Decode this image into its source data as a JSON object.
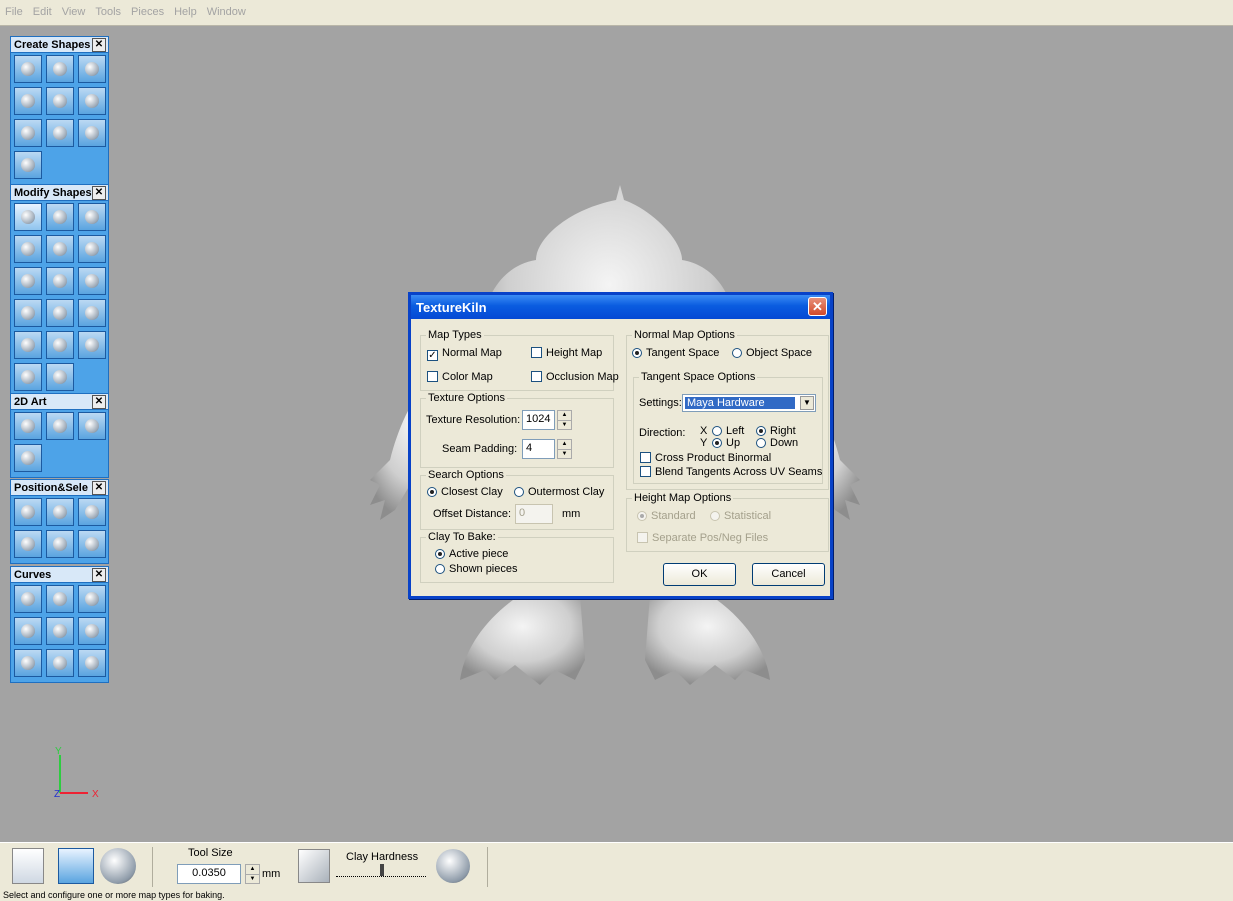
{
  "menubar": [
    "File",
    "Edit",
    "View",
    "Tools",
    "Pieces",
    "Help",
    "Window"
  ],
  "palettes": [
    {
      "title": "Create Shapes",
      "tools": 10
    },
    {
      "title": "Modify Shapes",
      "tools": 17
    },
    {
      "title": "2D Art",
      "tools": 4
    },
    {
      "title": "Position&Sele",
      "tools": 6
    },
    {
      "title": "Curves",
      "tools": 9
    }
  ],
  "dialog": {
    "title": "TextureKiln",
    "map_types": {
      "legend": "Map Types",
      "normal": "Normal Map",
      "normal_checked": true,
      "height": "Height Map",
      "height_checked": false,
      "color": "Color Map",
      "color_checked": false,
      "occlusion": "Occlusion Map",
      "occlusion_checked": false
    },
    "texture_options": {
      "legend": "Texture Options",
      "resolution_label": "Texture Resolution:",
      "resolution_value": "1024",
      "seam_label": "Seam Padding:",
      "seam_value": "4"
    },
    "search_options": {
      "legend": "Search Options",
      "closest": "Closest Clay",
      "outermost": "Outermost Clay",
      "selected": "closest",
      "offset_label": "Offset Distance:",
      "offset_value": "0",
      "offset_unit": "mm"
    },
    "clay_to_bake": {
      "legend": "Clay To Bake:",
      "active": "Active piece",
      "shown": "Shown pieces",
      "selected": "active"
    },
    "normal_map_options": {
      "legend": "Normal Map Options",
      "tangent": "Tangent Space",
      "object": "Object Space",
      "selected": "tangent"
    },
    "tangent_space_options": {
      "legend": "Tangent Space Options",
      "settings_label": "Settings:",
      "settings_value": "Maya Hardware",
      "direction_label": "Direction:",
      "x_axis": "X",
      "y_axis": "Y",
      "left": "Left",
      "right": "Right",
      "x_selected": "right",
      "up": "Up",
      "down": "Down",
      "y_selected": "up",
      "cross_product": "Cross Product Binormal",
      "blend_tangents": "Blend Tangents Across UV Seams"
    },
    "height_map_options": {
      "legend": "Height Map Options",
      "standard": "Standard",
      "statistical": "Statistical",
      "separate": "Separate Pos/Neg Files"
    },
    "ok": "OK",
    "cancel": "Cancel"
  },
  "toolbar": {
    "tool_size_label": "Tool Size",
    "tool_size_value": "0.0350",
    "tool_size_unit": "mm",
    "clay_hardness_label": "Clay Hardness"
  },
  "axes": {
    "y": "Y",
    "z": "Z",
    "x": "X"
  },
  "status": "Select and configure one or more map types for baking."
}
